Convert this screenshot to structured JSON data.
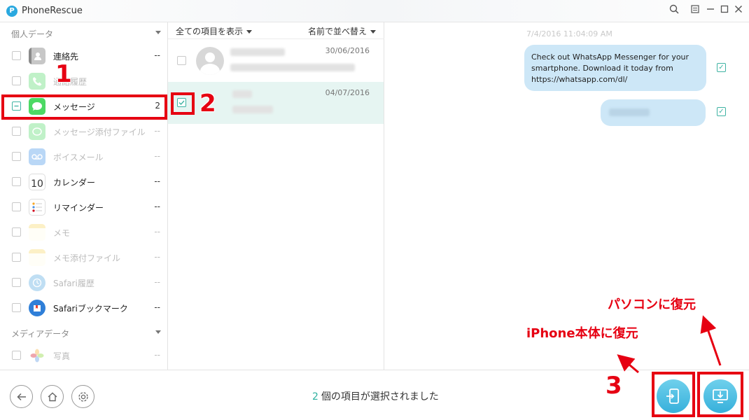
{
  "window": {
    "title": "PhoneRescue",
    "logo_letter": "P"
  },
  "sidebar": {
    "personal_header": "個人データ",
    "media_header": "メディアデータ",
    "items": [
      {
        "label": "連絡先",
        "count": "--",
        "icon": "contacts-icon",
        "dim": false
      },
      {
        "label": "通話履歴",
        "count": "",
        "icon": "phone-icon",
        "dim": true
      },
      {
        "label": "メッセージ",
        "count": "2",
        "icon": "messages-icon",
        "dim": false
      },
      {
        "label": "メッセージ添付ファイル",
        "count": "--",
        "icon": "attachment-icon",
        "dim": true
      },
      {
        "label": "ボイスメール",
        "count": "--",
        "icon": "voicemail-icon",
        "dim": true
      },
      {
        "label": "カレンダー",
        "count": "--",
        "icon": "calendar-icon",
        "dim": false
      },
      {
        "label": "リマインダー",
        "count": "--",
        "icon": "reminders-icon",
        "dim": false
      },
      {
        "label": "メモ",
        "count": "--",
        "icon": "notes-icon",
        "dim": true
      },
      {
        "label": "メモ添付ファイル",
        "count": "--",
        "icon": "notes-attachment-icon",
        "dim": true
      },
      {
        "label": "Safari履歴",
        "count": "--",
        "icon": "safari-history-icon",
        "dim": true
      },
      {
        "label": "Safariブックマーク",
        "count": "--",
        "icon": "safari-bookmark-icon",
        "dim": false
      },
      {
        "label": "写真",
        "count": "--",
        "icon": "photos-icon",
        "dim": true
      }
    ],
    "calendar_day": "10"
  },
  "list": {
    "filter_label": "全ての項目を表示",
    "sort_label": "名前で並べ替え",
    "conversations": [
      {
        "date": "30/06/2016"
      },
      {
        "date": "04/07/2016"
      }
    ]
  },
  "chat": {
    "timestamp": "7/4/2016 11:04:09 AM",
    "message_text": "Check out WhatsApp Messenger for your smartphone. Download it today from https://whatsapp.com/dl/"
  },
  "footer": {
    "selected_count": "2",
    "status_text": "個の項目が選択されました"
  },
  "annotations": {
    "step1": "1",
    "step2": "2",
    "step3": "3",
    "restore_to_iphone": "iPhone本体に復元",
    "restore_to_pc": "パソコンに復元",
    "color": "#e60012"
  },
  "colors": {
    "accent": "#2fb1a0",
    "bubble": "#cde7f7",
    "selected_row": "#e6f5f2",
    "action_button": "#37b0db"
  }
}
